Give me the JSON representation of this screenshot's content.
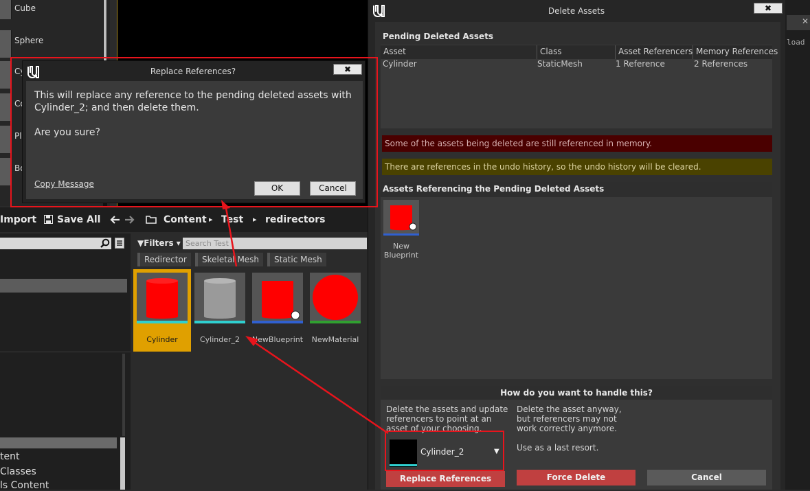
{
  "place_actors": {
    "items": [
      {
        "label": "Cube"
      },
      {
        "label": "Sphere"
      },
      {
        "label": "Cy"
      },
      {
        "label": "Co"
      },
      {
        "label": "Pl"
      },
      {
        "label": "Bo"
      }
    ]
  },
  "content_browser": {
    "import_label": "Import",
    "save_all_label": "Save All",
    "breadcrumb": [
      "Content",
      "Test",
      "redirectors"
    ],
    "filters_label": "Filters",
    "search_placeholder": "Search Test",
    "filter_chips": [
      "Redirector",
      "Skeletal Mesh",
      "Static Mesh"
    ],
    "assets": [
      {
        "name": "Cylinder",
        "selected": true
      },
      {
        "name": "Cylinder_2",
        "selected": false
      },
      {
        "name": "NewBlueprint",
        "selected": false
      },
      {
        "name": "NewMaterial",
        "selected": false
      }
    ],
    "tree": [
      "tent",
      "Classes",
      "ls Content"
    ]
  },
  "replace_dialog": {
    "title": "Replace References?",
    "close_label": "✖",
    "message": "This will replace any reference to the pending deleted assets with Cylinder_2; and then delete them.",
    "question": "Are you sure?",
    "copy_label": "Copy Message",
    "ok_label": "OK",
    "cancel_label": "Cancel"
  },
  "delete_window": {
    "title": "Delete Assets",
    "close_label": "✖",
    "pending_title": "Pending Deleted Assets",
    "columns": [
      "Asset",
      "Class",
      "Asset Referencers",
      "Memory References"
    ],
    "rows": [
      {
        "asset": "Cylinder",
        "class": "StaticMesh",
        "referencers": "1 Reference",
        "memory": "2 References"
      }
    ],
    "warn_memory": "Some of the assets being deleted are still referenced in memory.",
    "warn_undo": "There are references in the undo history, so the undo history will be cleared.",
    "referencing_title": "Assets Referencing the Pending Deleted Assets",
    "referencing_assets": [
      {
        "line1": "New",
        "line2": "Blueprint"
      }
    ],
    "handle_title": "How do you want to handle this?",
    "replace_desc": "Delete the assets and update referencers to point at an asset of your choosing.",
    "force_desc": "Delete the asset anyway, but referencers may not work correctly anymore.",
    "last_resort": "Use as a last resort.",
    "replacement_asset": "Cylinder_2",
    "replace_button": "Replace References",
    "force_button": "Force Delete",
    "cancel_button": "Cancel"
  },
  "far_right": {
    "close_glyph": "✕",
    "text": "load"
  },
  "colors": {
    "annotation_red": "#e8141c",
    "selected_tile": "#e0a000",
    "force_delete": "#c04040",
    "cancel_gray": "#5a5a5a"
  }
}
